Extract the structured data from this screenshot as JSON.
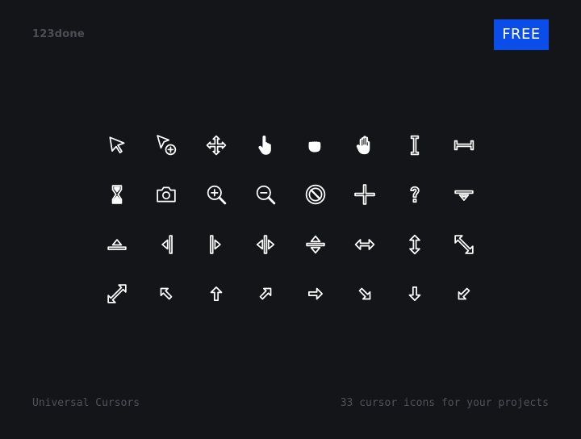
{
  "header": {
    "logo_text": "123done",
    "cta_label": "FREE"
  },
  "colors": {
    "background": "#141519",
    "accent": "#0a4de8",
    "icon": "#ffffff",
    "muted_text": "#4f5259"
  },
  "icons": [
    [
      "arrow-cursor-icon",
      "arrow-plus-cursor-icon",
      "move-cursor-icon",
      "pointer-hand-cursor-icon",
      "grabbing-hand-cursor-icon",
      "open-hand-cursor-icon",
      "text-ibeam-cursor-icon",
      "horizontal-ibeam-cursor-icon"
    ],
    [
      "hourglass-cursor-icon",
      "camera-cursor-icon",
      "zoom-in-cursor-icon",
      "zoom-out-cursor-icon",
      "not-allowed-cursor-icon",
      "crosshair-cursor-icon",
      "help-cursor-icon",
      "row-resize-down-cursor-icon"
    ],
    [
      "row-resize-up-cursor-icon",
      "column-resize-left-cursor-icon",
      "column-resize-right-cursor-icon",
      "col-split-cursor-icon",
      "row-split-cursor-icon",
      "ew-resize-cursor-icon",
      "ns-resize-cursor-icon",
      "nwse-resize-cursor-icon"
    ],
    [
      "nesw-resize-cursor-icon",
      "arrow-nw-cursor-icon",
      "arrow-up-cursor-icon",
      "arrow-ne-cursor-icon",
      "arrow-right-cursor-icon",
      "arrow-se-cursor-icon",
      "arrow-down-cursor-icon",
      "arrow-sw-cursor-icon"
    ]
  ],
  "footer": {
    "title": "Universal Cursors",
    "tagline": "33 cursor icons for your projects"
  }
}
